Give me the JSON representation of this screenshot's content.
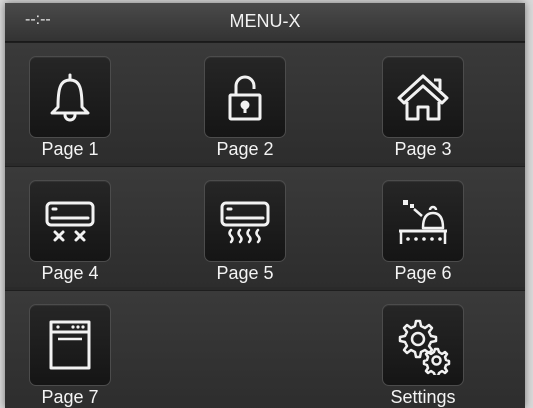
{
  "topbar": {
    "clock": "--:--",
    "title": "MENU-X"
  },
  "tiles": [
    {
      "label": "Page 1",
      "icon": "bell-icon"
    },
    {
      "label": "Page 2",
      "icon": "unlocked-padlock-icon"
    },
    {
      "label": "Page 3",
      "icon": "home-icon"
    },
    {
      "label": "Page 4",
      "icon": "air-conditioner-off-icon"
    },
    {
      "label": "Page 5",
      "icon": "air-conditioner-heat-icon"
    },
    {
      "label": "Page 6",
      "icon": "bell-pan-scene-icon"
    },
    {
      "label": "Page 7",
      "icon": "oven-icon"
    },
    {
      "label": "Settings",
      "icon": "gears-icon"
    }
  ],
  "colors": {
    "background": "#2a2a2a",
    "button": "#1c1c1c",
    "text": "#f4f4f4"
  }
}
